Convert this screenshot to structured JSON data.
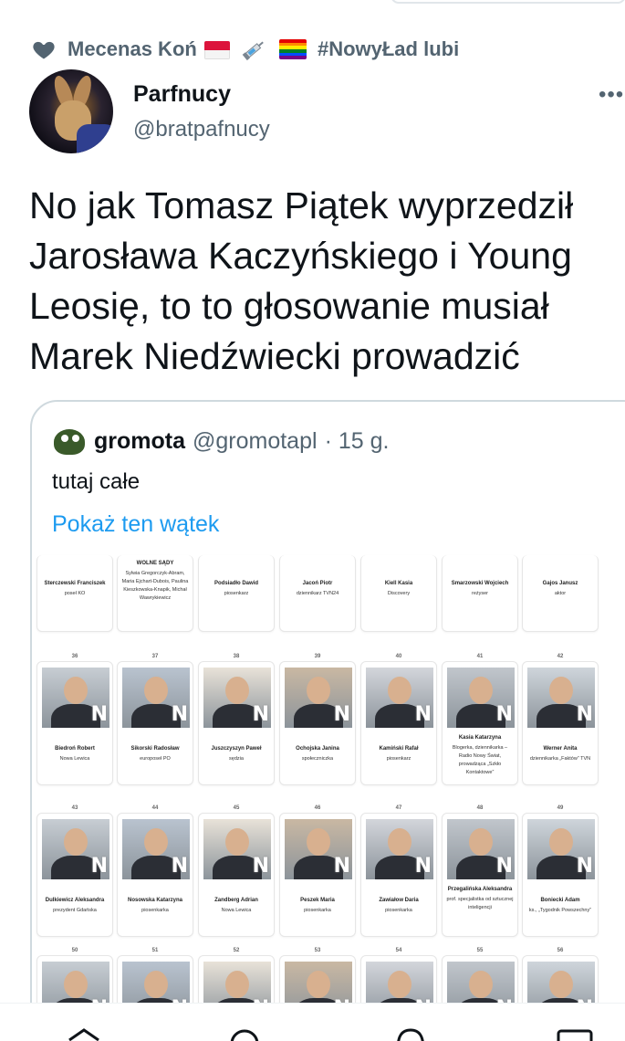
{
  "retweet": {
    "name": "Mecenas Koń",
    "hashtag": "#NowyŁad lubi"
  },
  "author": {
    "display_name": "Parfnucy",
    "handle": "@bratpafnucy"
  },
  "tweet": {
    "text": "No jak Tomasz Piątek wyprzedził Jarosława Kaczyńskiego i Young Leosię, to to głosowanie musiał Marek Niedźwiecki prowadzić"
  },
  "quote": {
    "name": "gromota",
    "handle": "@gromotapl",
    "time": "· 15 g.",
    "text": "tutaj całe",
    "link": "Pokaż ten wątek"
  },
  "grid": {
    "header_label": "WOLNE SĄDY",
    "row0": [
      {
        "name": "Sterczewski Franciszek",
        "role": "poseł KO"
      },
      {
        "name": "",
        "role": "Sylwia Gregorczyk-Abram, Maria Ejchart-Dubois, Paulina Kieszkowska-Knapik, Michał Wawrykiewicz"
      },
      {
        "name": "Podsiadło Dawid",
        "role": "piosenkarz"
      },
      {
        "name": "Jacoń Piotr",
        "role": "dziennikarz TVN24"
      },
      {
        "name": "Kiell Kasia",
        "role": "Discovery"
      },
      {
        "name": "Smarzowski Wojciech",
        "role": "reżyser"
      },
      {
        "name": "Gajos Janusz",
        "role": "aktor"
      }
    ],
    "row1": [
      {
        "num": "36",
        "name": "Biedroń Robert",
        "role": "Nowa Lewica"
      },
      {
        "num": "37",
        "name": "Sikorski Radosław",
        "role": "europoseł PO"
      },
      {
        "num": "38",
        "name": "Juszczyszyn Paweł",
        "role": "sędzia"
      },
      {
        "num": "39",
        "name": "Ochojska Janina",
        "role": "społeczniczka"
      },
      {
        "num": "40",
        "name": "Kamiński Rafał",
        "role": "piosenkarz"
      },
      {
        "num": "41",
        "name": "Kasia Katarzyna",
        "role": "Blogerka, dziennikarka – Radio Nowy Świat, prowadząca „Szkło Kontaktowe”"
      },
      {
        "num": "42",
        "name": "Werner Anita",
        "role": "dziennikarka „Faktów” TVN"
      }
    ],
    "row2": [
      {
        "num": "43",
        "name": "Dulkiewicz Aleksandra",
        "role": "prezydent Gdańska"
      },
      {
        "num": "44",
        "name": "Nosowska Katarzyna",
        "role": "piosenkarka"
      },
      {
        "num": "45",
        "name": "Zandberg Adrian",
        "role": "Nowa Lewica"
      },
      {
        "num": "46",
        "name": "Peszek Maria",
        "role": "piosenkarka"
      },
      {
        "num": "47",
        "name": "Zawiałow Daria",
        "role": "piosenkarka"
      },
      {
        "num": "48",
        "name": "Przegalińska Aleksandra",
        "role": "prof. specjalistka od sztucznej inteligencji"
      },
      {
        "num": "49",
        "name": "Boniecki Adam",
        "role": "ks., „Tygodnik Powszechny”"
      }
    ],
    "row3": [
      {
        "num": "50"
      },
      {
        "num": "51"
      },
      {
        "num": "52"
      },
      {
        "num": "53"
      },
      {
        "num": "54"
      },
      {
        "num": "55"
      },
      {
        "num": "56"
      }
    ]
  },
  "colors": {
    "link": "#1d9bf0",
    "secondary": "#536471",
    "border": "#cfd9de"
  }
}
